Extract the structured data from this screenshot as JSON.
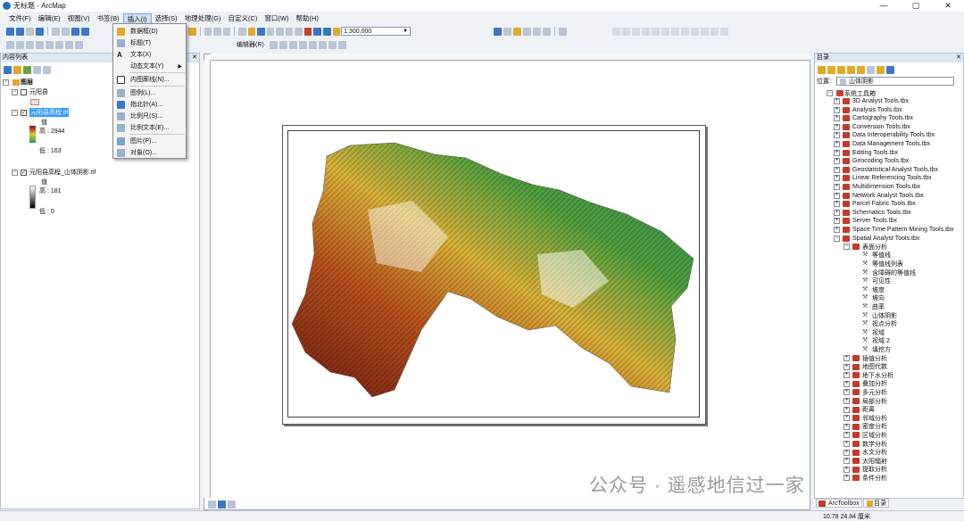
{
  "window": {
    "title": "无标题 - ArcMap",
    "minimize": "—",
    "maximize": "▢",
    "close": "✕"
  },
  "menu": [
    "文件(F)",
    "编辑(E)",
    "视图(V)",
    "书签(B)",
    "插入(I)",
    "选择(S)",
    "地理处理(G)",
    "自定义(C)",
    "窗口(W)",
    "帮助(H)"
  ],
  "toolbar": {
    "scale": "1:300,000",
    "editor_label": "编辑器(R)·"
  },
  "insert_menu": [
    {
      "label": "数据框(D)"
    },
    {
      "label": "标题(T)"
    },
    {
      "label": "文本(X)"
    },
    {
      "label": "动态文本(Y)",
      "sub": "▶"
    },
    {
      "label": "内图廓线(N)..."
    },
    {
      "label": "图例(L)..."
    },
    {
      "label": "指北针(A)..."
    },
    {
      "label": "比例尺(S)..."
    },
    {
      "label": "比例文本(E)..."
    },
    {
      "label": "图片(P)..."
    },
    {
      "label": "对象(O)..."
    }
  ],
  "toc": {
    "title": "内容列表",
    "layers_root": "图层",
    "items": [
      {
        "name": "元阳县",
        "checked": false
      },
      {
        "name": "元阳县高程.tif",
        "checked": true,
        "selected": true,
        "value_label": "值",
        "high": "高 : 2944",
        "low": "低 : 163"
      },
      {
        "name": "元阳县高程_山体阴影.tif",
        "checked": true,
        "value_label": "值",
        "high": "高 : 181",
        "low": "低 : 0"
      }
    ]
  },
  "catalog": {
    "title": "目录",
    "location_label": "位置:",
    "location_value": "山体阴影",
    "root": "系统工具箱",
    "toolboxes": [
      "3D Analyst Tools.tbx",
      "Analysis Tools.tbx",
      "Cartography Tools.tbx",
      "Conversion Tools.tbx",
      "Data Interoperability Tools.tbx",
      "Data Management Tools.tbx",
      "Editing Tools.tbx",
      "Geocoding Tools.tbx",
      "Geostatistical Analyst Tools.tbx",
      "Linear Referencing Tools.tbx",
      "Multidimension Tools.tbx",
      "Network Analyst Tools.tbx",
      "Parcel Fabric Tools.tbx",
      "Schematics Tools.tbx",
      "Server Tools.tbx",
      "Space Time Pattern Mining Tools.tbx",
      "Spatial Analyst Tools.tbx"
    ],
    "surface_group": "表面分析",
    "surface_tools": [
      "等值线",
      "等值线列表",
      "含障碍的等值线",
      "可见性",
      "坡度",
      "坡向",
      "曲率",
      "山体阴影",
      "视点分析",
      "视域",
      "视域 2",
      "填挖方"
    ],
    "other_groups": [
      "插值分析",
      "地图代数",
      "地下水分析",
      "叠加分析",
      "多元分析",
      "局部分析",
      "距离",
      "邻域分析",
      "密度分析",
      "区域分析",
      "数学分析",
      "水文分析",
      "太阳辐射",
      "提取分析",
      "条件分析"
    ]
  },
  "bottom_tabs": [
    "ArcToolbox",
    "目录"
  ],
  "status": {
    "coords": "10.78  24.84 厘米"
  },
  "watermark": "公众号 · 遥感地信过一家",
  "colors": {
    "accent": "#3d77c4",
    "selection": "#3399ff",
    "toolbox": "#c23a2b"
  }
}
